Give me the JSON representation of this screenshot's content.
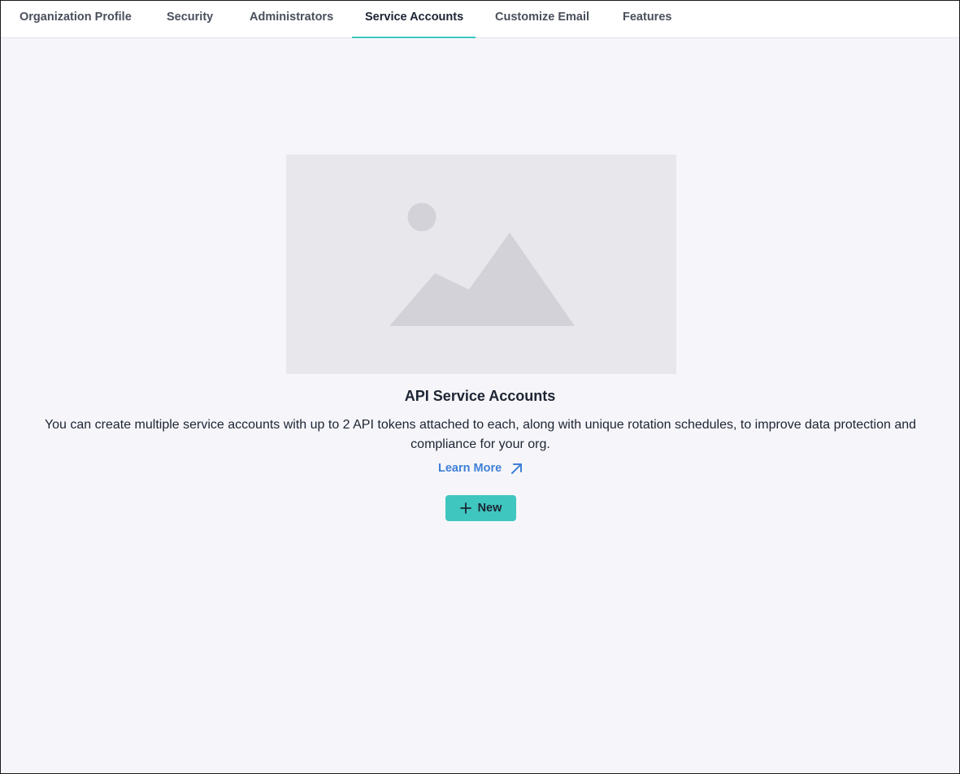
{
  "tabs": [
    {
      "label": "Organization Profile",
      "active": false
    },
    {
      "label": "Security",
      "active": false
    },
    {
      "label": "Administrators",
      "active": false
    },
    {
      "label": "Service Accounts",
      "active": true
    },
    {
      "label": "Customize Email",
      "active": false
    },
    {
      "label": "Features",
      "active": false
    }
  ],
  "empty_state": {
    "illustration_icon": "image-placeholder-icon",
    "title": "API Service Accounts",
    "description": "You can create multiple service accounts with up to 2 API tokens attached to each, along with unique rotation schedules, to improve data protection and compliance for your org.",
    "learn_more_label": "Learn More",
    "learn_more_icon": "external-link-arrow-icon",
    "new_button_label": "New",
    "new_button_icon": "plus-icon"
  },
  "colors": {
    "accent": "#3fc6bf",
    "link": "#3f7fd6",
    "background": "#f6f6fa",
    "placeholder": "#e8e8ec",
    "placeholder_shape": "#d3d2d8"
  }
}
